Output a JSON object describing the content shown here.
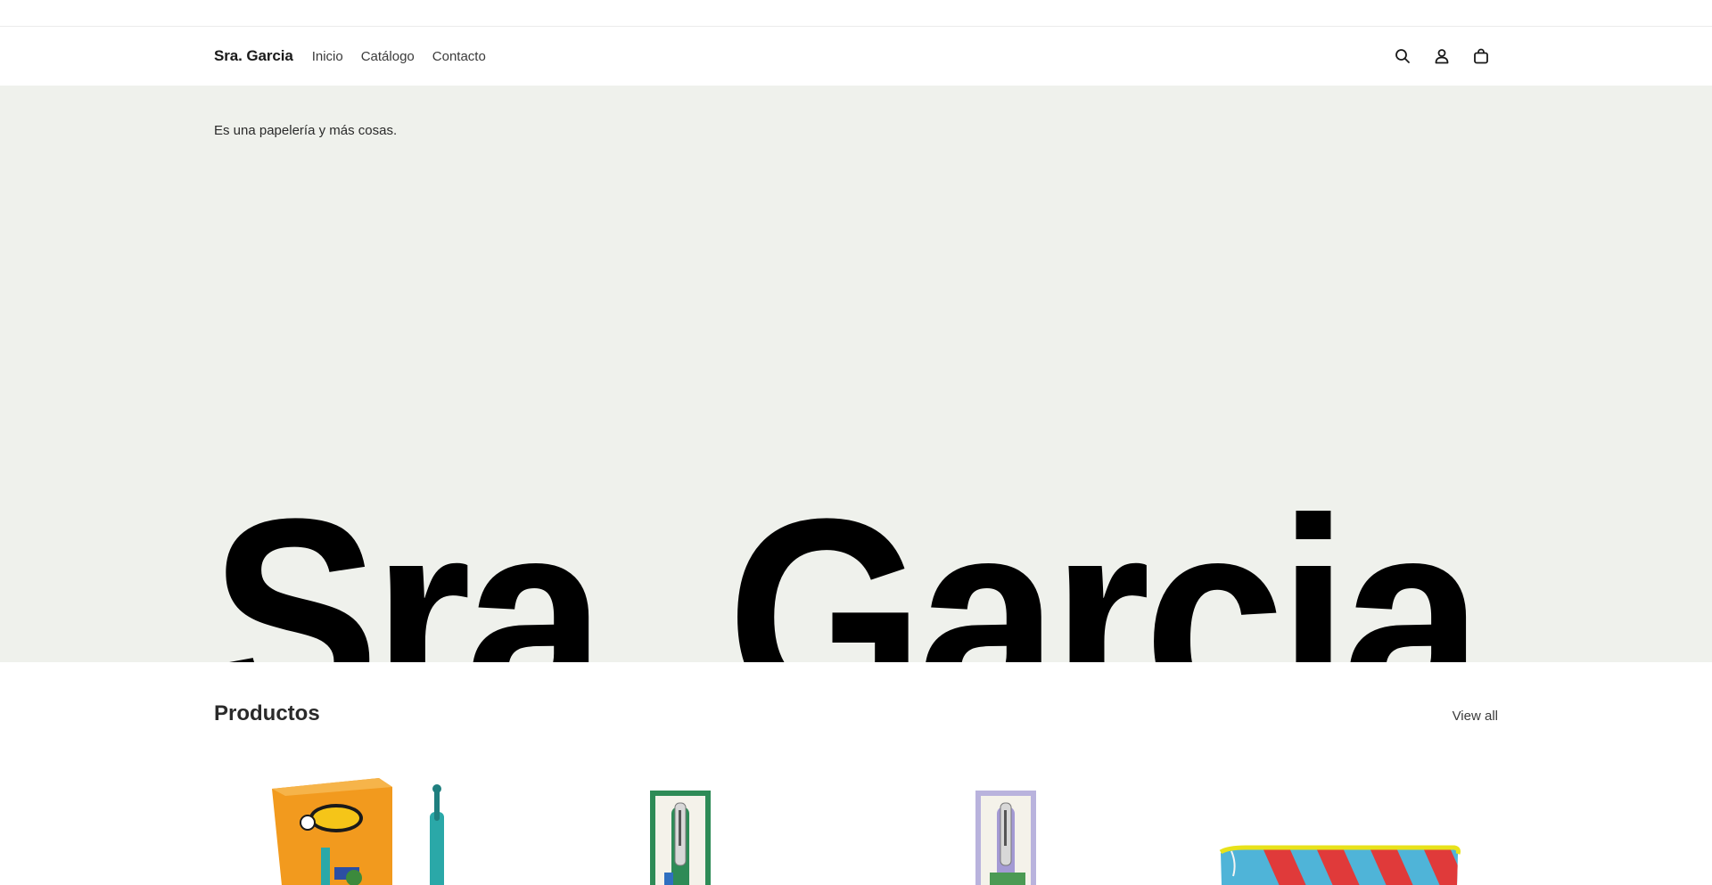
{
  "header": {
    "brand": "Sra. Garcia",
    "nav": [
      {
        "label": "Inicio"
      },
      {
        "label": "Catálogo"
      },
      {
        "label": "Contacto"
      }
    ],
    "icons": [
      "search-icon",
      "account-icon",
      "cart-icon"
    ]
  },
  "hero": {
    "tagline": "Es una papelería y más cosas.",
    "title": "Sra. Garcia",
    "background": "#eff1ec"
  },
  "products": {
    "title": "Productos",
    "view_all": "View all",
    "items": [
      {
        "image": "bic-4-colours-pens"
      },
      {
        "image": "green-fountain-pen-box"
      },
      {
        "image": "lilac-fountain-pen-box"
      },
      {
        "image": "striped-pencil-case"
      }
    ]
  },
  "colors": {
    "accent": "#1a1a1a",
    "hero_bg": "#eff1ec",
    "bic_orange": "#f29a1e",
    "teal": "#2aa8a8"
  }
}
